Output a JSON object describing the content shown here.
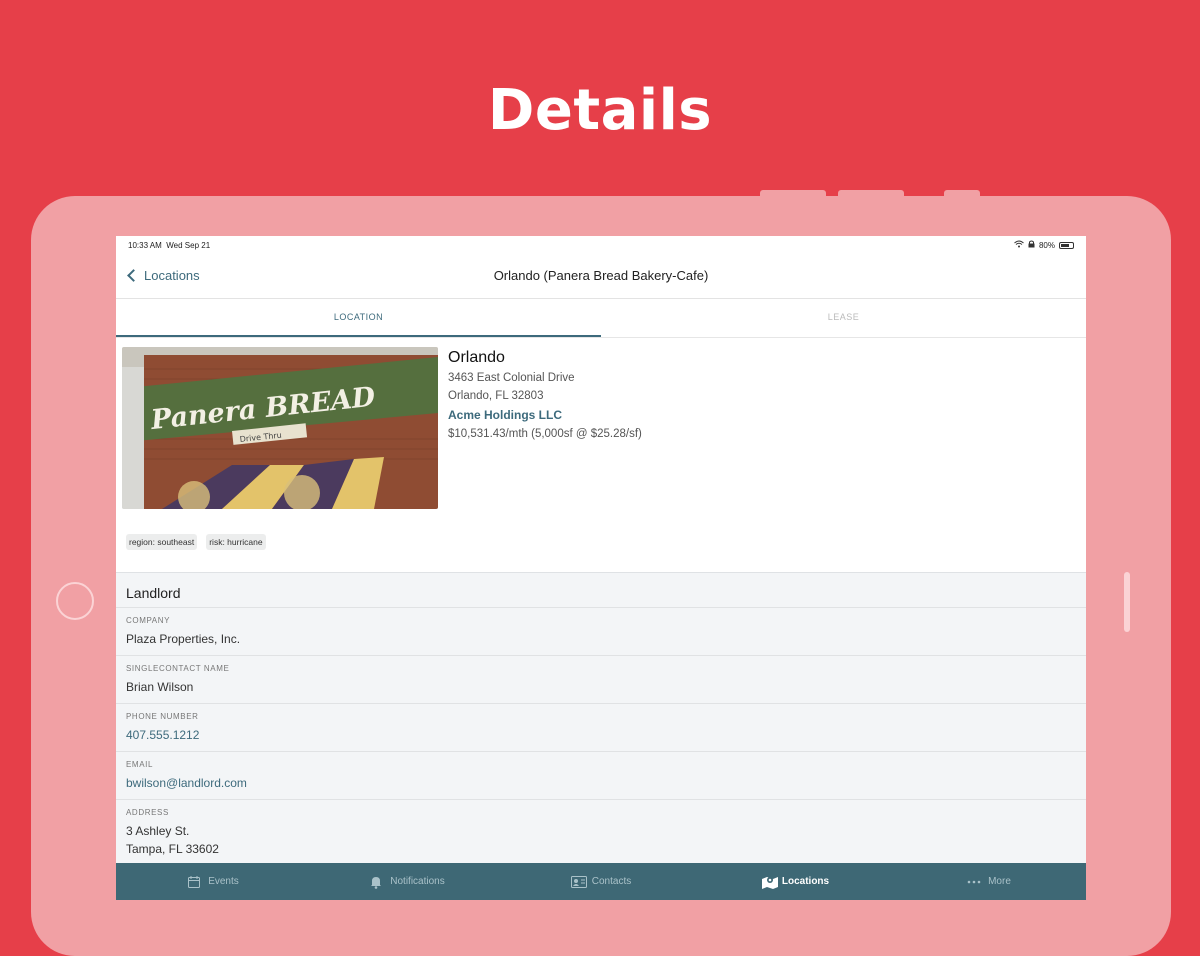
{
  "headline": "Details",
  "status_bar": {
    "time": "10:33 AM",
    "date": "Wed Sep 21",
    "battery": "80%"
  },
  "nav": {
    "back_label": "Locations",
    "title": "Orlando (Panera Bread Bakery-Cafe)"
  },
  "tabs": [
    {
      "label": "LOCATION",
      "active": true
    },
    {
      "label": "LEASE",
      "active": false
    }
  ],
  "photo": {
    "sign_text": "Panera BREAD",
    "subsign_text": "Drive Thru"
  },
  "location": {
    "name": "Orlando",
    "street": "3463 East Colonial Drive",
    "city_line": "Orlando, FL 32803",
    "owner": "Acme Holdings LLC",
    "rent": "$10,531.43/mth (5,000sf @ $25.28/sf)"
  },
  "tags": [
    "region: southeast",
    "risk: hurricane"
  ],
  "landlord": {
    "title": "Landlord",
    "fields": [
      {
        "label": "COMPANY",
        "value": "Plaza Properties, Inc."
      },
      {
        "label": "SINGLECONTACT NAME",
        "value": "Brian Wilson"
      },
      {
        "label": "PHONE NUMBER",
        "value": "407.555.1212"
      },
      {
        "label": "EMAIL",
        "value": "bwilson@landlord.com"
      },
      {
        "label": "ADDRESS",
        "value": "3 Ashley St.",
        "value2": "Tampa, FL 33602"
      }
    ]
  },
  "tabbar": [
    {
      "label": "Events",
      "icon": "calendar-icon",
      "active": false
    },
    {
      "label": "Notifications",
      "icon": "bell-icon",
      "active": false
    },
    {
      "label": "Contacts",
      "icon": "contact-card-icon",
      "active": false
    },
    {
      "label": "Locations",
      "icon": "map-icon",
      "active": true
    },
    {
      "label": "More",
      "icon": "ellipsis-icon",
      "active": false
    }
  ],
  "colors": {
    "brand_red": "#e63f49",
    "accent_teal": "#3d6a7c",
    "tabbar_bg": "#3e6875"
  }
}
